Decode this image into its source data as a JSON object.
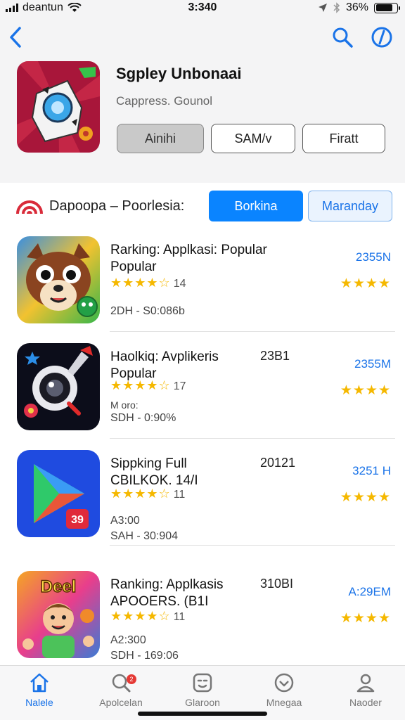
{
  "status": {
    "carrier": "deantun",
    "time": "3:340",
    "battery": "36%"
  },
  "header": {
    "title": "Sgpley Unbonaai",
    "subtitle": "Cappress. Gounol",
    "buttons": [
      "Ainihi",
      "SAM/v",
      "Firatt"
    ],
    "active_button": 0
  },
  "filter": {
    "label": "Dapoopa – Poorlesia:",
    "primary": "Borkina",
    "secondary": "Maranday"
  },
  "apps": [
    {
      "name": "Rarking: Applkasi: Popular",
      "name2": "Popular",
      "year": "",
      "stars_text": "★★★★☆",
      "count": "14",
      "extra": "",
      "meta": "2DH - S0:086b",
      "size": "2355N",
      "rstars": "★★★★"
    },
    {
      "name": "Haolkiq: Avplikeris",
      "name2": "Popular",
      "year": "23B1",
      "stars_text": "★★★★☆",
      "count": "17",
      "extra": "M oro:",
      "meta": "SDH - 0:90%",
      "size": "2355M",
      "rstars": "★★★★"
    },
    {
      "name": "Sippking Full",
      "name2": "CBILKOK.  14/I",
      "year": "20121",
      "stars_text": "★★★★☆",
      "count": "11",
      "extra": "A3:00",
      "meta": "SAH - 30:904",
      "size": "3251 H",
      "rstars": "★★★★"
    },
    {
      "name": "Ranking: Applkasis",
      "name2": "APOOERS.  (B1I",
      "year": "310BI",
      "stars_text": "★★★★☆",
      "count": "11",
      "extra": "A2:300",
      "meta": "SDH - 169:06",
      "size": "A:29EM",
      "rstars": "★★★★"
    }
  ],
  "tabs": [
    {
      "label": "Nalele",
      "icon": "home-icon"
    },
    {
      "label": "Apolcelan",
      "icon": "search-icon",
      "badge": "2"
    },
    {
      "label": "Glaroon",
      "icon": "games-icon"
    },
    {
      "label": "Mnegaa",
      "icon": "heart-icon"
    },
    {
      "label": "Naoder",
      "icon": "profile-icon"
    }
  ],
  "colors": {
    "accent": "#0a84ff",
    "star": "#f5b800",
    "header_bg": "#f4f4f5"
  }
}
